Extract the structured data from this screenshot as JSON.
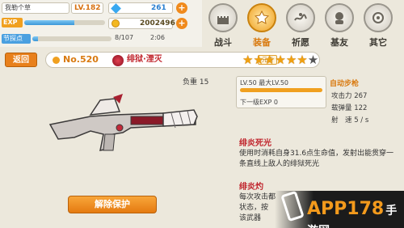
{
  "status": {
    "player_name": "我勒个草",
    "level": "LV.182",
    "gems": "261",
    "exp_label": "EXP",
    "exp_progress": 0.62,
    "gold": "2002496",
    "explore_label": "节探点",
    "explore_progress": 0.07,
    "explore_value": "8/107",
    "timer": "2:06"
  },
  "menu": {
    "items": [
      {
        "label": "战斗",
        "icon": "castle-icon"
      },
      {
        "label": "装备",
        "icon": "equipment-icon"
      },
      {
        "label": "祈愿",
        "icon": "wish-icon"
      },
      {
        "label": "基友",
        "icon": "friends-icon"
      },
      {
        "label": "其它",
        "icon": "other-icon"
      }
    ],
    "active": 1
  },
  "header": {
    "back_label": "返回",
    "number": "No.520",
    "weapon_name": "绯狱·湮灭",
    "tag": "元素",
    "stars_filled": 6,
    "stars_total": 7
  },
  "weapon": {
    "load": "负重 15"
  },
  "level_panel": {
    "level_text": "LV.50 最大LV.50",
    "progress": 1.0,
    "next_exp": "下一级EXP 0"
  },
  "stats": {
    "type": "自动步枪",
    "attack": "攻击力 267",
    "ammo": "载弹量 122",
    "speed": "射　速 5 / s"
  },
  "skills": [
    {
      "title": "绯炎死光",
      "desc": "使用时消耗自身31.6点生命值，发射出能贯穿一条直线上敌人的绯狱死光"
    },
    {
      "title": "绯炎灼",
      "desc": "每次攻击都\n状态，按\n该武器"
    }
  ],
  "unprotect_label": "解除保护",
  "watermark": {
    "brand": "APP178",
    "suffix": "手游网",
    "colors": {
      "brand": "#f39a1c"
    }
  }
}
